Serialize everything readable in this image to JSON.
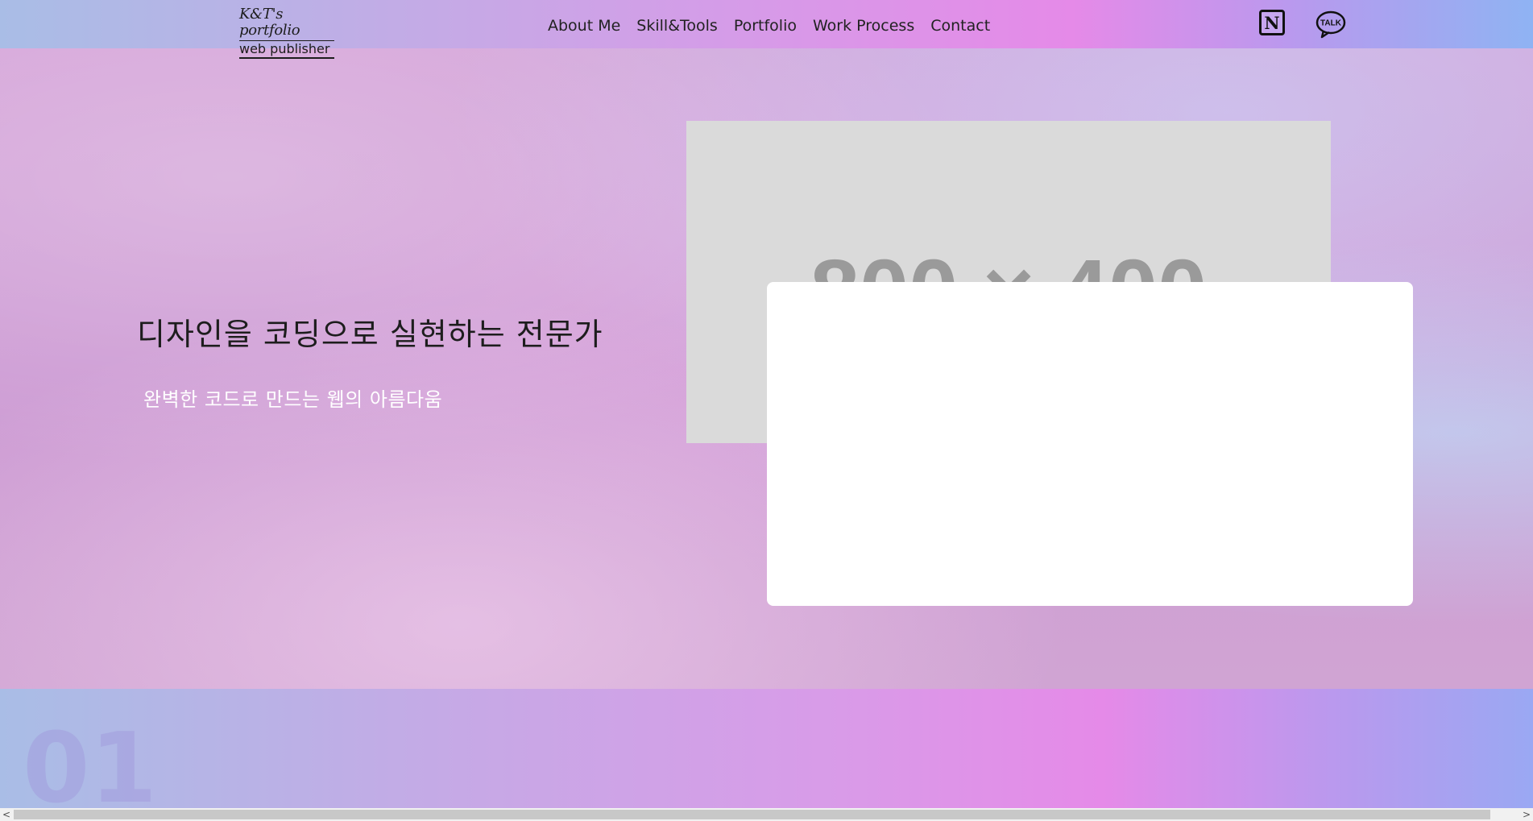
{
  "header": {
    "logo_script": "K&T's portfolio",
    "logo_sub": "web publisher",
    "nav": [
      {
        "label": "About Me"
      },
      {
        "label": "Skill&Tools"
      },
      {
        "label": "Portfolio"
      },
      {
        "label": "Work Process"
      },
      {
        "label": "Contact"
      }
    ],
    "notion_icon_letter": "N",
    "talk_icon_text": "TALK"
  },
  "hero": {
    "title": "디자인을 코딩으로 실현하는 전문가",
    "subtitle": "완벽한 코드로 만드는 웹의 아름다움",
    "placeholder_text": "800 × 400"
  },
  "section": {
    "number": "01"
  },
  "scrollbar": {
    "left_arrow": "<",
    "right_arrow": ">"
  },
  "colors": {
    "accent_pink": "#e58ae8",
    "accent_blue": "#8fb3f3",
    "placeholder_bg": "#dadada",
    "placeholder_text": "#9a9a9a"
  }
}
